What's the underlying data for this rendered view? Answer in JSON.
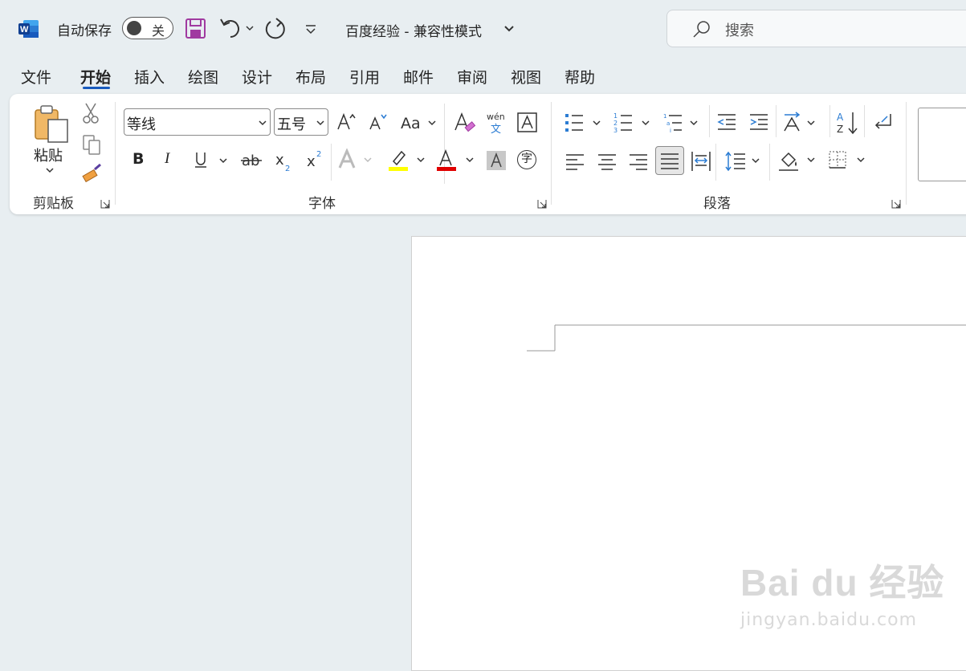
{
  "titlebar": {
    "autosave_label": "自动保存",
    "autosave_state": "关",
    "document_title": "百度经验  -  兼容性模式",
    "search_placeholder": "搜索"
  },
  "tabs": [
    "文件",
    "开始",
    "插入",
    "绘图",
    "设计",
    "布局",
    "引用",
    "邮件",
    "审阅",
    "视图",
    "帮助"
  ],
  "active_tab": "开始",
  "ribbon": {
    "clipboard": {
      "paste_label": "粘贴",
      "group_label": "剪贴板"
    },
    "font": {
      "font_name": "等线",
      "font_size": "五号",
      "group_label": "字体",
      "phonetic_top": "wén",
      "phonetic_bottom": "文",
      "char_circle": "字"
    },
    "paragraph": {
      "group_label": "段落"
    }
  },
  "colors": {
    "accent": "#185abd",
    "highlight": "#ffff00",
    "font_color": "#e00000"
  },
  "watermark": {
    "brand": "Bai du 经验",
    "url": "jingyan.baidu.com"
  }
}
